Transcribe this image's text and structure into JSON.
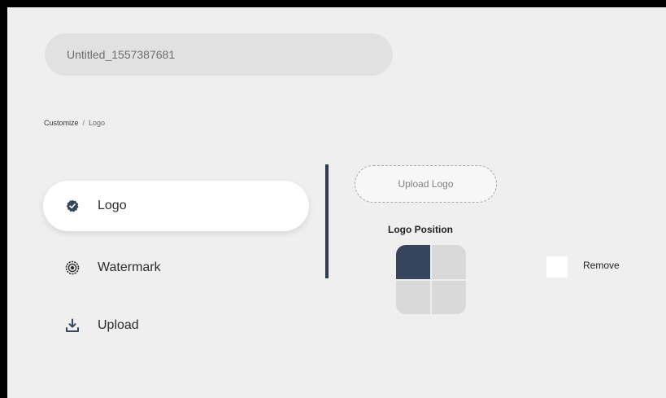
{
  "project": {
    "title": "Untitled_1557387681"
  },
  "breadcrumb": {
    "root": "Customize",
    "separator": "/",
    "current": "Logo"
  },
  "nav": {
    "items": [
      {
        "label": "Logo",
        "icon": "badge-check-icon",
        "active": true
      },
      {
        "label": "Watermark",
        "icon": "watermark-icon",
        "active": false
      },
      {
        "label": "Upload",
        "icon": "upload-icon",
        "active": false
      }
    ]
  },
  "logo_panel": {
    "upload_label": "Upload Logo",
    "position_label": "Logo Position",
    "selected_position": "top-left",
    "remove_label": "Remove",
    "remove_checked": false
  },
  "colors": {
    "accent": "#36455b",
    "background": "#efefef"
  }
}
